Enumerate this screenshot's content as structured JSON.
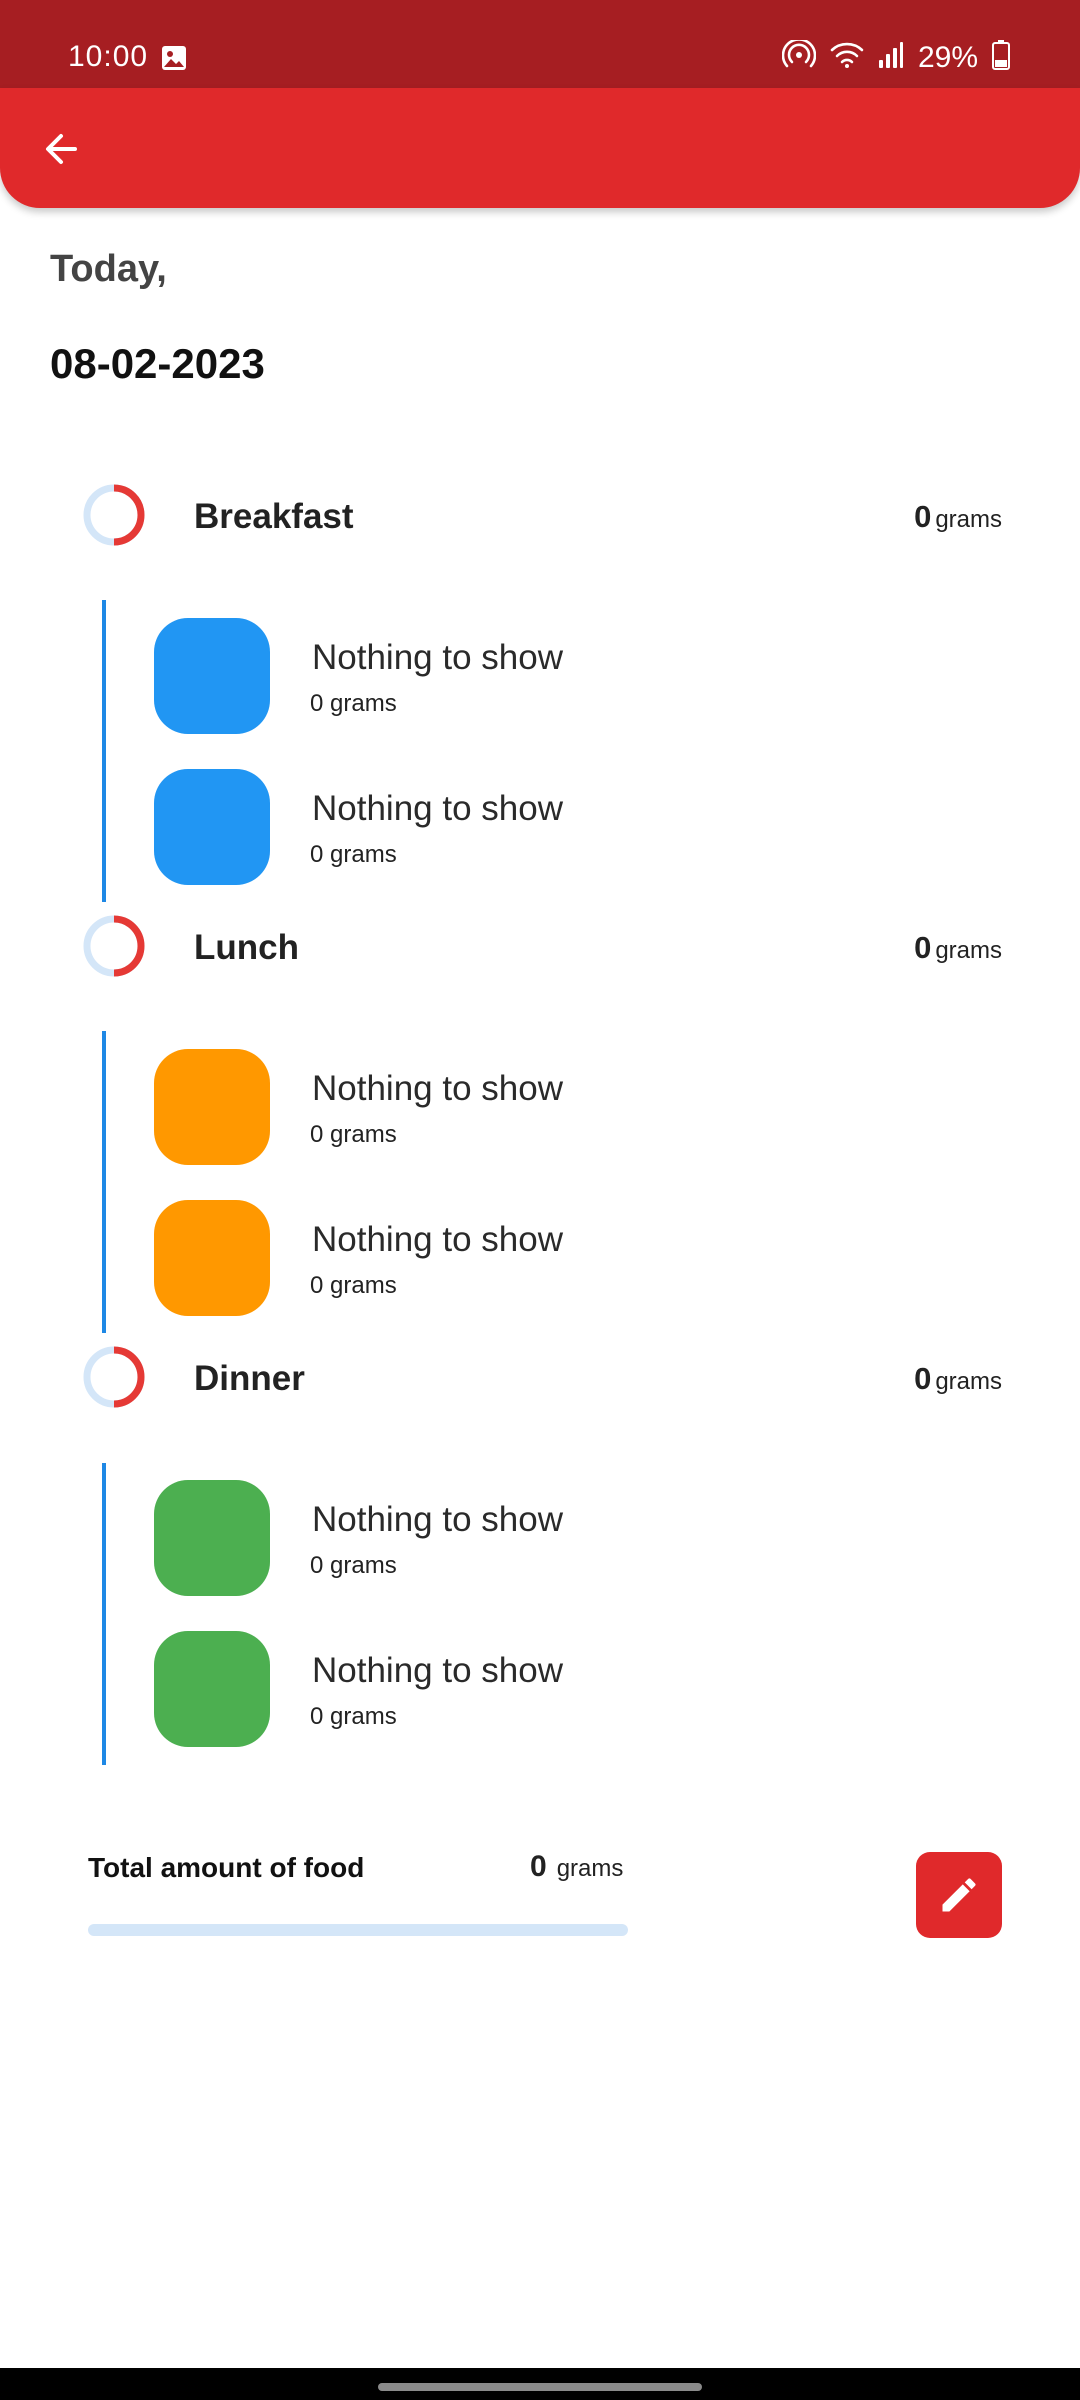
{
  "status_bar": {
    "time": "10:00",
    "battery": "29%",
    "icons": [
      "gallery-icon",
      "hotspot-icon",
      "wifi-icon",
      "signal-icon",
      "battery-icon"
    ]
  },
  "app_bar": {
    "back_icon": "arrow-left-icon",
    "color": "#e0292b"
  },
  "date": {
    "label": "Today,",
    "value": "08-02-2023"
  },
  "meals": [
    {
      "name": "Breakfast",
      "amount": "0",
      "unit": "grams",
      "color": "#2196f3",
      "items": [
        {
          "name": "Nothing to show",
          "grams": "0 grams"
        },
        {
          "name": "Nothing to show",
          "grams": "0 grams"
        }
      ]
    },
    {
      "name": "Lunch",
      "amount": "0",
      "unit": "grams",
      "color": "#ff9800",
      "items": [
        {
          "name": "Nothing to show",
          "grams": "0 grams"
        },
        {
          "name": "Nothing to show",
          "grams": "0 grams"
        }
      ]
    },
    {
      "name": "Dinner",
      "amount": "0",
      "unit": "grams",
      "color": "#4caf50",
      "items": [
        {
          "name": "Nothing to show",
          "grams": "0 grams"
        },
        {
          "name": "Nothing to show",
          "grams": "0 grams"
        }
      ]
    }
  ],
  "total": {
    "label": "Total amount of food",
    "amount": "0",
    "unit": "grams",
    "progress": 0
  },
  "edit_button": {
    "icon": "pencil-icon"
  }
}
